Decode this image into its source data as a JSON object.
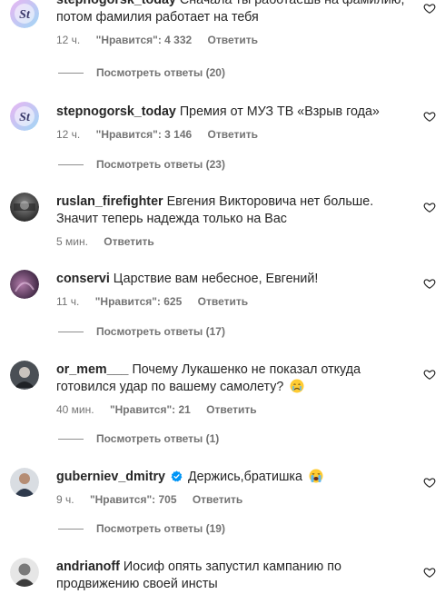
{
  "comments": [
    {
      "username": "stepnogorsk_today",
      "text": "Сначала ты работаешь на фамилию, потом фамилия работает на тебя",
      "time": "12 ч.",
      "likes": "\"Нравится\": 4 332",
      "reply": "Ответить",
      "view_replies": "Посмотреть ответы (20)",
      "avatar_icon": "st-logo-avatar"
    },
    {
      "username": "stepnogorsk_today",
      "text": "Премия от МУЗ ТВ «Взрыв года»",
      "time": "12 ч.",
      "likes": "\"Нравится\": 3 146",
      "reply": "Ответить",
      "view_replies": "Посмотреть ответы (23)",
      "avatar_icon": "st-logo-avatar"
    },
    {
      "username": "ruslan_firefighter",
      "text": "Евгения Викторовича нет больше. Значит теперь надежда только на Вас",
      "time": "5 мин.",
      "reply": "Ответить",
      "avatar_icon": "photo-avatar"
    },
    {
      "username": "conservi",
      "text": "Царствие вам небесное, Евгений!",
      "time": "11 ч.",
      "likes": "\"Нравится\": 625",
      "reply": "Ответить",
      "view_replies": "Посмотреть ответы (17)",
      "avatar_icon": "photo-avatar"
    },
    {
      "username": "or_mem___",
      "text": "Почему Лукашенко не показал откуда готовился удар по вашему самолету?",
      "time": "40 мин.",
      "likes": "\"Нравится\": 21",
      "reply": "Ответить",
      "view_replies": "Посмотреть ответы (1)",
      "avatar_icon": "photo-avatar",
      "emoji": "crying-face-emoji"
    },
    {
      "username": "guberniev_dmitry",
      "verified": true,
      "text": "Держись,братишка",
      "time": "9 ч.",
      "likes": "\"Нравится\": 705",
      "reply": "Ответить",
      "view_replies": "Посмотреть ответы (19)",
      "avatar_icon": "photo-avatar",
      "emoji": "loudly-crying-face-emoji"
    },
    {
      "username": "andrianoff",
      "text": "Иосиф опять запустил кампанию по продвижению своей инсты",
      "avatar_icon": "photo-avatar"
    }
  ],
  "colors": {
    "text": "#262626",
    "secondary": "#737373",
    "verified": "#0095f6",
    "background": "#ffffff"
  },
  "icons": {
    "like": "heart-outline-icon",
    "verified": "verified-badge-icon"
  }
}
